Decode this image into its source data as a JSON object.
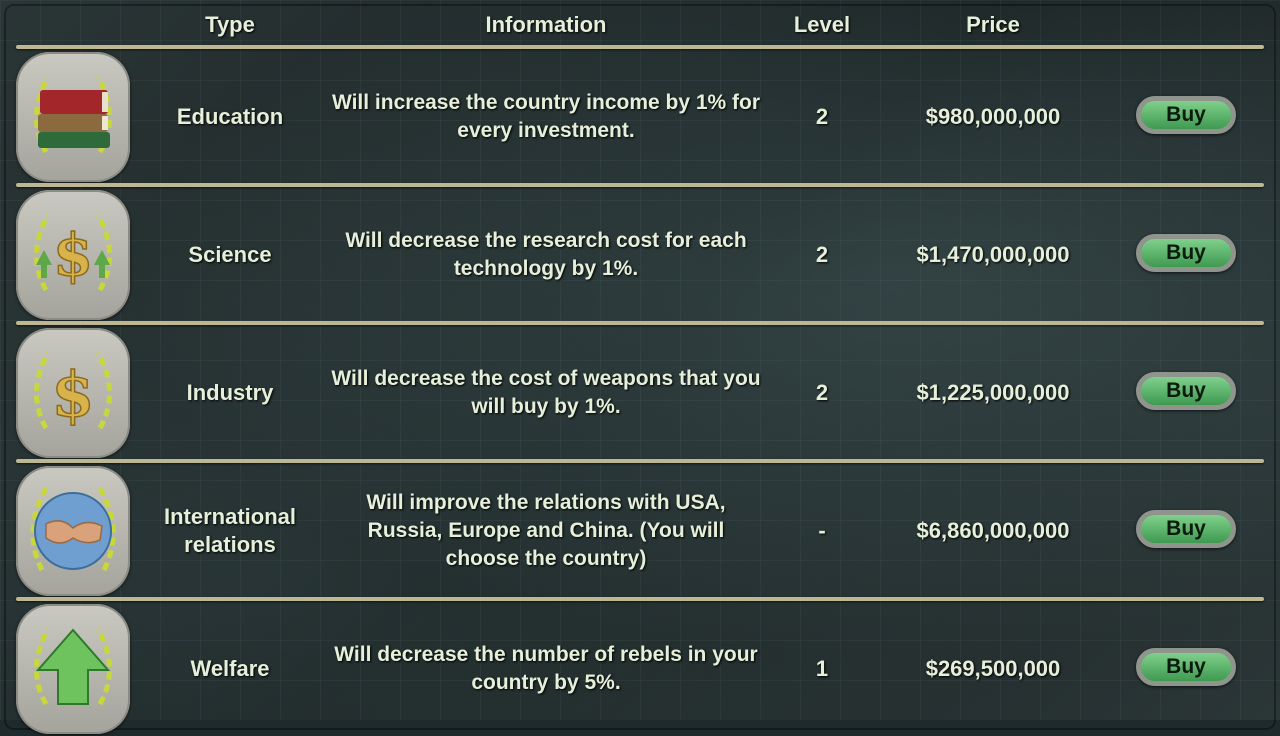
{
  "header": {
    "type": "Type",
    "information": "Information",
    "level": "Level",
    "price": "Price"
  },
  "rows": [
    {
      "icon": "books-icon",
      "type": "Education",
      "information": "Will increase the country income by 1% for every investment.",
      "level": "2",
      "price": "$980,000,000",
      "buy": "Buy"
    },
    {
      "icon": "dollar-arrows-icon",
      "type": "Science",
      "information": "Will decrease the research cost for each technology by 1%.",
      "level": "2",
      "price": "$1,470,000,000",
      "buy": "Buy"
    },
    {
      "icon": "dollar-icon",
      "type": "Industry",
      "information": "Will decrease the cost of weapons that you will buy by 1%.",
      "level": "2",
      "price": "$1,225,000,000",
      "buy": "Buy"
    },
    {
      "icon": "handshake-globe-icon",
      "type": "International relations",
      "information": "Will improve the relations with USA, Russia, Europe and China. (You will choose the country)",
      "level": "-",
      "price": "$6,860,000,000",
      "buy": "Buy"
    },
    {
      "icon": "up-arrow-icon",
      "type": "Welfare",
      "information": "Will decrease the number of rebels in your country by 5%.",
      "level": "1",
      "price": "$269,500,000",
      "buy": "Buy"
    }
  ],
  "colors": {
    "text": "#e6efd9",
    "divider": "#bdb893",
    "button": "#4faa5f"
  }
}
